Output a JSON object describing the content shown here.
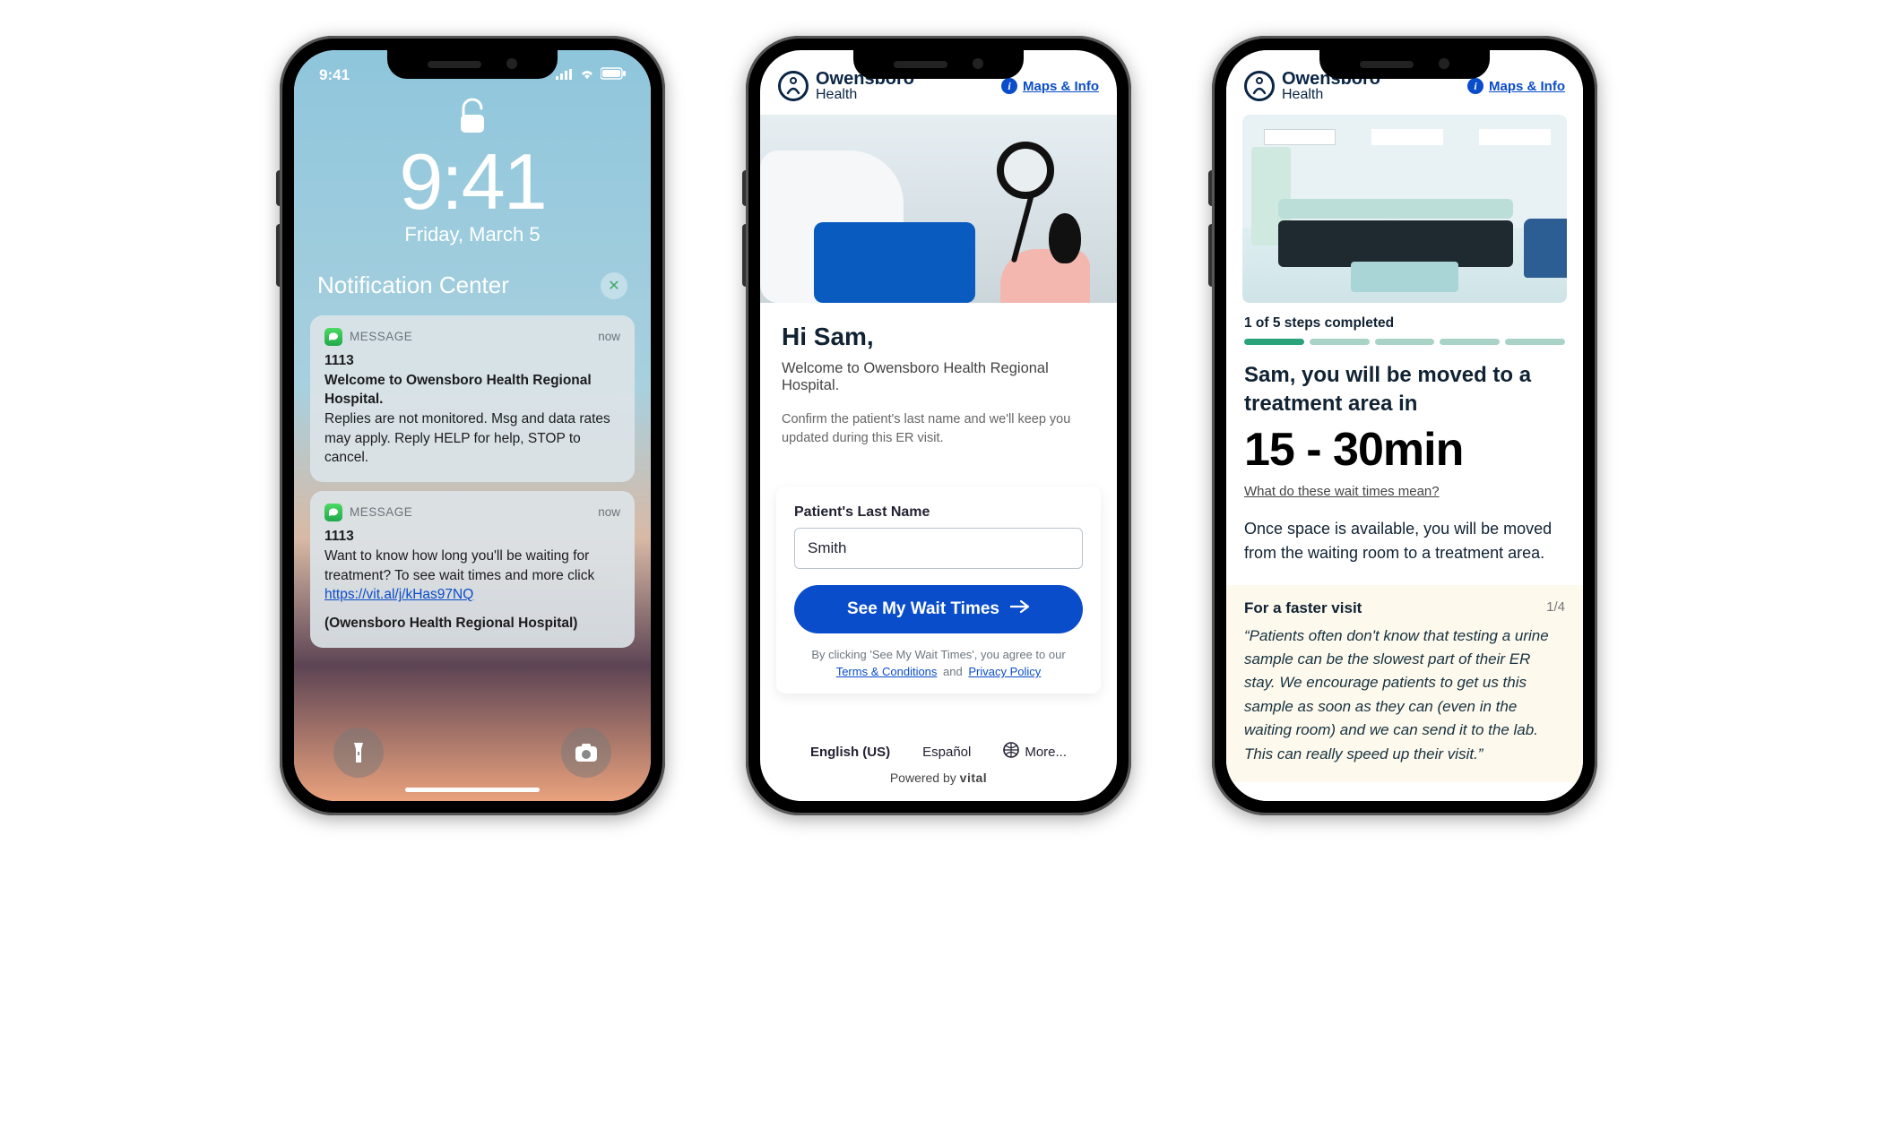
{
  "phone1": {
    "status_time": "9:41",
    "big_time": "9:41",
    "date": "Friday, March 5",
    "nc_title": "Notification Center",
    "notifs": [
      {
        "app": "MESSAGE",
        "when": "now",
        "sender": "1113",
        "line1": "Welcome to Owensboro Health Regional Hospital.",
        "line2": "Replies are not monitored. Msg and data rates may apply. Reply HELP for help, STOP to cancel."
      },
      {
        "app": "MESSAGE",
        "when": "now",
        "sender": "1113",
        "body_pre": "Want to know how long you'll be waiting for treatment? To see wait times and more click ",
        "link": "https://vit.al/j/kHas97NQ",
        "source": "(Owensboro Health Regional Hospital)"
      }
    ]
  },
  "brand": {
    "line1": "Owensboro",
    "line2": "Health"
  },
  "maps_link": "Maps & Info",
  "phone2": {
    "greeting": "Hi Sam,",
    "welcome": "Welcome to Owensboro Health Regional Hospital.",
    "helper": "Confirm the patient's last name and we'll keep you updated during this ER visit.",
    "field_label": "Patient's Last Name",
    "field_value": "Smith",
    "cta": "See My Wait Times",
    "legal_pre": "By clicking 'See My Wait Times', you agree to our",
    "legal_terms": "Terms & Conditions",
    "legal_and": "and",
    "legal_privacy": "Privacy Policy",
    "lang_en": "English (US)",
    "lang_es": "Español",
    "lang_more": "More...",
    "powered_pre": "Powered by ",
    "powered_brand": "vital"
  },
  "phone3": {
    "steps_label": "1 of 5 steps completed",
    "steps_done": 1,
    "steps_total": 5,
    "title": "Sam, you will be moved to a treatment area in",
    "time": "15 - 30min",
    "wait_link": "What do these wait times mean?",
    "desc": "Once space is available, you will be moved from the waiting room to a treatment area.",
    "tip_title": "For a faster visit",
    "tip_page": "1/4",
    "tip_body": "“Patients often don't know that testing a urine sample can be the slowest part of their ER stay.  We encourage patients to get us this sample as soon as they can (even in the waiting room) and we can send it to the lab.  This can really speed up their visit.”"
  }
}
